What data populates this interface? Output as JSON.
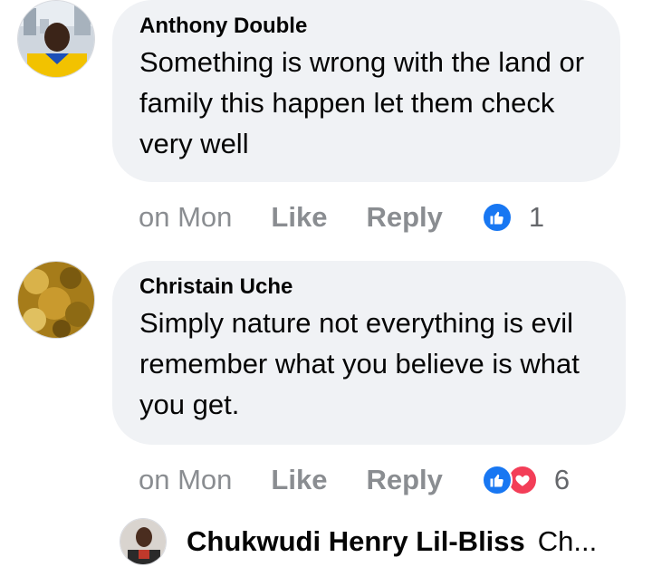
{
  "comments": [
    {
      "author": "Anthony Double",
      "text": "Something is wrong with the land or family this happen let them check very well",
      "time": "on Mon",
      "like_label": "Like",
      "reply_label": "Reply",
      "reactions": [
        "like-icon"
      ],
      "reaction_count": "1"
    },
    {
      "author": "Christain Uche",
      "text": "Simply nature not everything is evil remember what you believe is what you get.",
      "time": "on Mon",
      "like_label": "Like",
      "reply_label": "Reply",
      "reactions": [
        "like-icon",
        "love-icon"
      ],
      "reaction_count": "6"
    }
  ],
  "reply_preview": {
    "author": "Chukwudi Henry Lil-Bliss",
    "snippet": "Ch..."
  },
  "colors": {
    "bubble": "#f0f2f5",
    "meta_text": "#8a8d91",
    "like_blue": "#1877f2",
    "love_red": "#f33e58"
  }
}
